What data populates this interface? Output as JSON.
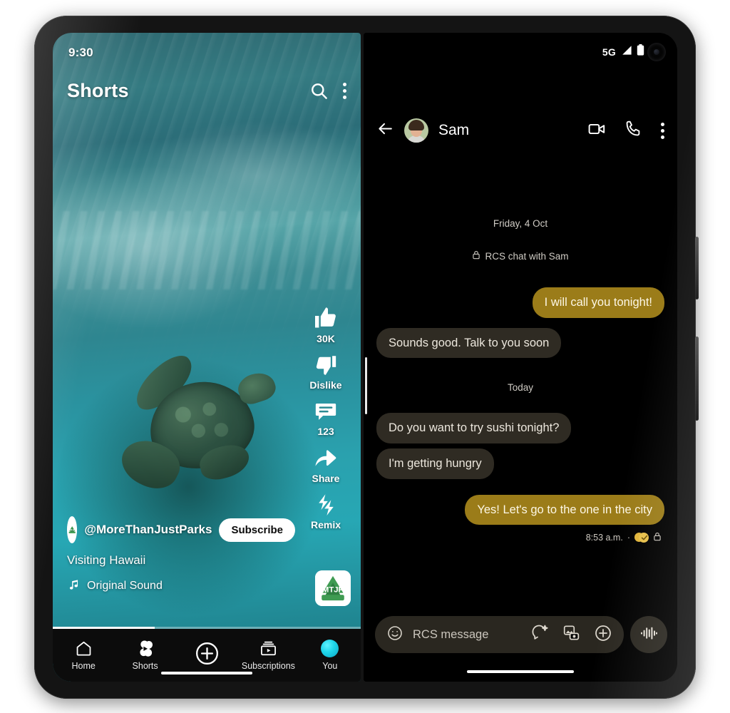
{
  "device": {
    "name": "foldable-phone"
  },
  "left_screen": {
    "app": "YouTube Shorts",
    "status_bar": {
      "time": "9:30"
    },
    "topbar": {
      "title": "Shorts",
      "search_icon": "search-icon",
      "more_icon": "more-vertical-icon"
    },
    "rail": [
      {
        "icon": "thumbs-up-icon",
        "label": "30K"
      },
      {
        "icon": "thumbs-down-icon",
        "label": "Dislike"
      },
      {
        "icon": "comment-icon",
        "label": "123"
      },
      {
        "icon": "share-icon",
        "label": "Share"
      },
      {
        "icon": "remix-icon",
        "label": "Remix"
      }
    ],
    "meta": {
      "channel_avatar_text": "MTJP",
      "channel_handle": "@MoreThanJustParks",
      "subscribe_label": "Subscribe",
      "video_title": "Visiting Hawaii",
      "sound_icon": "music-note-icon",
      "sound_label": "Original Sound",
      "remix_thumb_text": "MTJP"
    },
    "progress_percent": 33,
    "bottom_nav": [
      {
        "icon": "home-icon",
        "label": "Home"
      },
      {
        "icon": "shorts-icon",
        "label": "Shorts"
      },
      {
        "icon": "plus-circle-icon",
        "label": ""
      },
      {
        "icon": "subscriptions-icon",
        "label": "Subscriptions"
      },
      {
        "icon": "account-avatar-icon",
        "label": "You"
      }
    ]
  },
  "right_screen": {
    "app": "Google Messages",
    "status_bar": {
      "network": "5G",
      "signal_icon": "signal-icon",
      "battery_icon": "battery-icon"
    },
    "header": {
      "back_icon": "back-arrow-icon",
      "contact_name": "Sam",
      "video_call_icon": "video-call-icon",
      "call_icon": "phone-call-icon",
      "more_icon": "more-vertical-icon"
    },
    "thread": [
      {
        "type": "date",
        "text": "Friday, 4 Oct"
      },
      {
        "type": "note",
        "icon": "lock-icon",
        "text": "RCS chat with Sam"
      },
      {
        "type": "message",
        "side": "out",
        "text": "I will call you tonight!"
      },
      {
        "type": "message",
        "side": "in",
        "text": "Sounds good. Talk to you soon"
      },
      {
        "type": "date",
        "text": "Today"
      },
      {
        "type": "message",
        "side": "in",
        "text": "Do you want to try sushi tonight?"
      },
      {
        "type": "message",
        "side": "in",
        "text": "I'm getting hungry"
      },
      {
        "type": "message",
        "side": "out",
        "text": "Yes! Let's go to the one in the city"
      }
    ],
    "last_message_meta": {
      "time": "8:53 a.m.",
      "separator": "·",
      "reaction_icon": "reaction-emoji-icon",
      "delivered_icon": "delivered-check-icon",
      "lock_icon": "lock-icon"
    },
    "composer": {
      "emoji_icon": "emoji-smiley-icon",
      "placeholder": "RCS message",
      "value": "",
      "sticker_icon": "sticker-sparkle-icon",
      "gallery_icon": "gallery-icon",
      "plus_icon": "plus-circle-icon",
      "mic_icon": "voice-waveform-icon"
    }
  },
  "colors": {
    "outgoing_bubble": "#9b7c19",
    "incoming_bubble": "#2f2b23",
    "composer_bg": "#2a2720",
    "accent_teal": "#1fd6ea",
    "screen_bg": "#000000"
  }
}
